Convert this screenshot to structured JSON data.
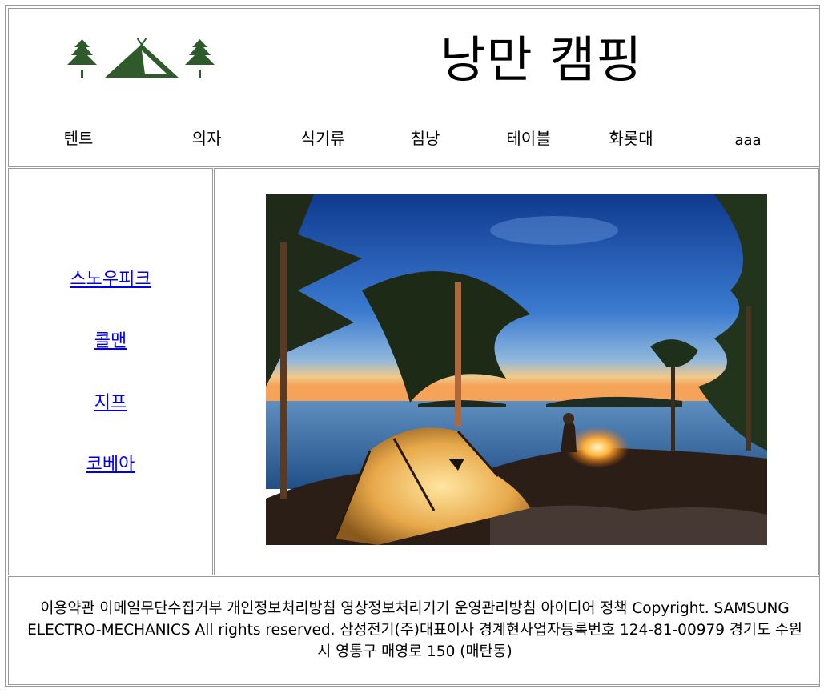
{
  "header": {
    "title": "낭만 캠핑",
    "logo_icon": "tent-and-pines-logo",
    "logo_color": "#2f5a2c"
  },
  "nav": {
    "items": [
      {
        "label": "텐트"
      },
      {
        "label": "의자"
      },
      {
        "label": "식기류"
      },
      {
        "label": "침낭"
      },
      {
        "label": "테이블"
      },
      {
        "label": "화롯대"
      },
      {
        "label": "aaa"
      }
    ]
  },
  "sidebar": {
    "links": [
      {
        "label": "스노우피크"
      },
      {
        "label": "콜맨"
      },
      {
        "label": "지프"
      },
      {
        "label": "코베아"
      }
    ],
    "link_color": "#0000ee"
  },
  "main": {
    "image_icon": "camping-lake-photo"
  },
  "footer": {
    "text": "이용약관 이메일무단수집거부 개인정보처리방침 영상정보처리기기 운영관리방침 아이디어 정책 Copyright. SAMSUNG ELECTRO-MECHANICS All rights reserved. 삼성전기(주)대표이사 경계현사업자등록번호 124-81-00979 경기도 수원시 영통구 매영로 150 (매탄동)"
  }
}
